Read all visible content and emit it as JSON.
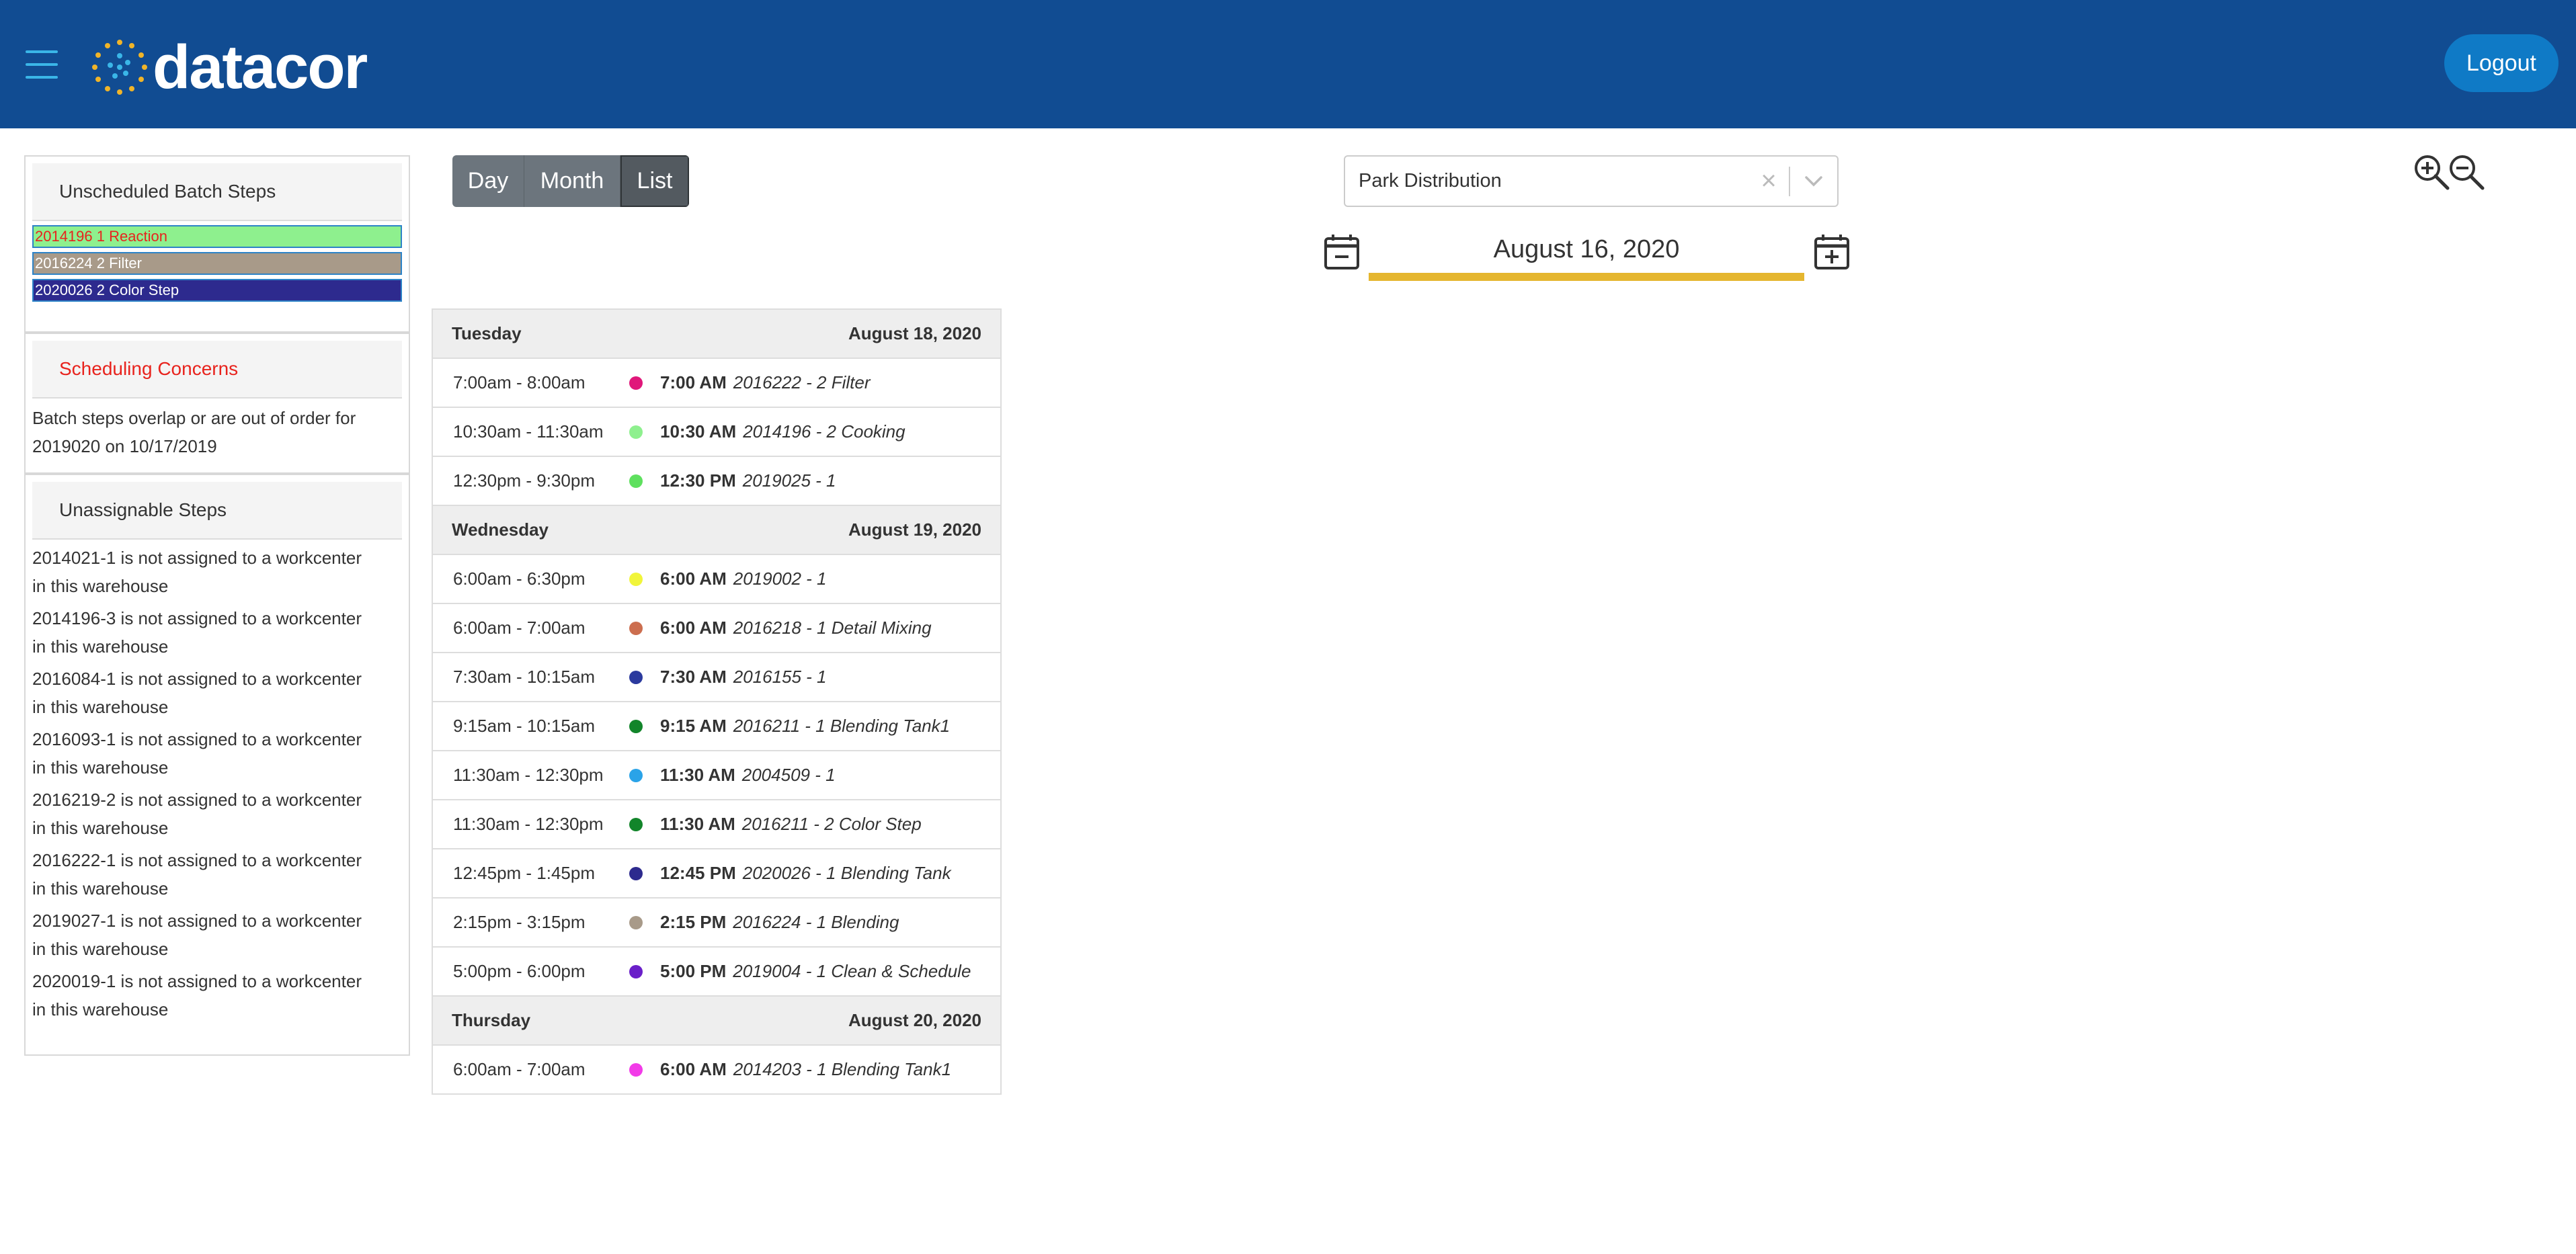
{
  "app": {
    "logo_text": "datacor",
    "logout_label": "Logout"
  },
  "left_panel": {
    "unscheduled": {
      "title": "Unscheduled Batch Steps",
      "items": [
        {
          "label": "2014196 1 Reaction",
          "bg": "#8ef08e",
          "fg": "#e8231d"
        },
        {
          "label": "2016224 2 Filter",
          "bg": "#a89a89",
          "fg": "#ffffff"
        },
        {
          "label": "2020026 2 Color Step",
          "bg": "#2d2a8e",
          "fg": "#ffffff"
        }
      ]
    },
    "concerns": {
      "title": "Scheduling Concerns",
      "text_line1": "Batch steps overlap or are out of order for",
      "text_line2": "2019020 on 10/17/2019"
    },
    "unassignable": {
      "title": "Unassignable Steps",
      "items": [
        {
          "line1": "2014021-1 is not assigned to a workcenter",
          "line2": "in this warehouse"
        },
        {
          "line1": "2014196-3 is not assigned to a workcenter",
          "line2": "in this warehouse"
        },
        {
          "line1": "2016084-1 is not assigned to a workcenter",
          "line2": "in this warehouse"
        },
        {
          "line1": "2016093-1 is not assigned to a workcenter",
          "line2": "in this warehouse"
        },
        {
          "line1": "2016219-2 is not assigned to a workcenter",
          "line2": "in this warehouse"
        },
        {
          "line1": "2016222-1 is not assigned to a workcenter",
          "line2": "in this warehouse"
        },
        {
          "line1": "2019027-1 is not assigned to a workcenter",
          "line2": "in this warehouse"
        },
        {
          "line1": "2020019-1 is not assigned to a workcenter",
          "line2": "in this warehouse"
        }
      ]
    }
  },
  "views": {
    "day": "Day",
    "month": "Month",
    "list": "List",
    "active": "List"
  },
  "warehouse": {
    "selected": "Park Distribution",
    "clear_glyph": "×"
  },
  "date_nav": {
    "current": "August 16, 2020"
  },
  "schedule": [
    {
      "weekday": "Tuesday",
      "date": "August 18, 2020",
      "events": [
        {
          "range": "7:00am - 8:00am",
          "start": "7:00 AM",
          "title": "2016222 - 2 Filter",
          "color": "#e0177a"
        },
        {
          "range": "10:30am - 11:30am",
          "start": "10:30 AM",
          "title": "2014196 - 2 Cooking",
          "color": "#8ef08e"
        },
        {
          "range": "12:30pm - 9:30pm",
          "start": "12:30 PM",
          "title": "2019025 - 1",
          "color": "#5ee05e"
        }
      ]
    },
    {
      "weekday": "Wednesday",
      "date": "August 19, 2020",
      "events": [
        {
          "range": "6:00am - 6:30pm",
          "start": "6:00 AM",
          "title": "2019002 - 1",
          "color": "#f1f53a"
        },
        {
          "range": "6:00am - 7:00am",
          "start": "6:00 AM",
          "title": "2016218 - 1 Detail Mixing",
          "color": "#cc6e4f"
        },
        {
          "range": "7:30am - 10:15am",
          "start": "7:30 AM",
          "title": "2016155 - 1",
          "color": "#2b3a9e"
        },
        {
          "range": "9:15am - 10:15am",
          "start": "9:15 AM",
          "title": "2016211 - 1 Blending Tank1",
          "color": "#12852a"
        },
        {
          "range": "11:30am - 12:30pm",
          "start": "11:30 AM",
          "title": "2004509 - 1",
          "color": "#2aa3e8"
        },
        {
          "range": "11:30am - 12:30pm",
          "start": "11:30 AM",
          "title": "2016211 - 2 Color Step",
          "color": "#12852a"
        },
        {
          "range": "12:45pm - 1:45pm",
          "start": "12:45 PM",
          "title": "2020026 - 1 Blending Tank",
          "color": "#2d2a8e"
        },
        {
          "range": "2:15pm - 3:15pm",
          "start": "2:15 PM",
          "title": "2016224 - 1 Blending",
          "color": "#a89a89"
        },
        {
          "range": "5:00pm - 6:00pm",
          "start": "5:00 PM",
          "title": "2019004 - 1 Clean & Schedule",
          "color": "#6a1fc9"
        }
      ]
    },
    {
      "weekday": "Thursday",
      "date": "August 20, 2020",
      "events": [
        {
          "range": "6:00am - 7:00am",
          "start": "6:00 AM",
          "title": "2014203 - 1 Blending Tank1",
          "color": "#f23be8"
        }
      ]
    }
  ]
}
